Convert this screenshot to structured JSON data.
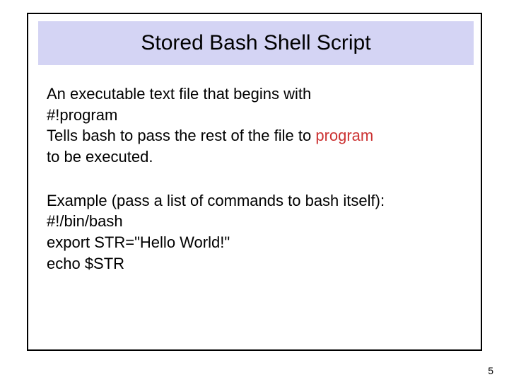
{
  "slide": {
    "title": "Stored Bash Shell Script",
    "para1_line1": "An executable text file that begins with",
    "para1_line2": "#!program",
    "para1_line3_a": "Tells bash to pass the rest of the file to ",
    "para1_line3_b": "program",
    "para1_line4": "to be executed.",
    "para2_line1": "Example (pass a list of commands to bash itself):",
    "para2_line2": "#!/bin/bash",
    "para2_line3": "export STR=\"Hello World!\"",
    "para2_line4": "echo $STR",
    "page_number": "5"
  }
}
